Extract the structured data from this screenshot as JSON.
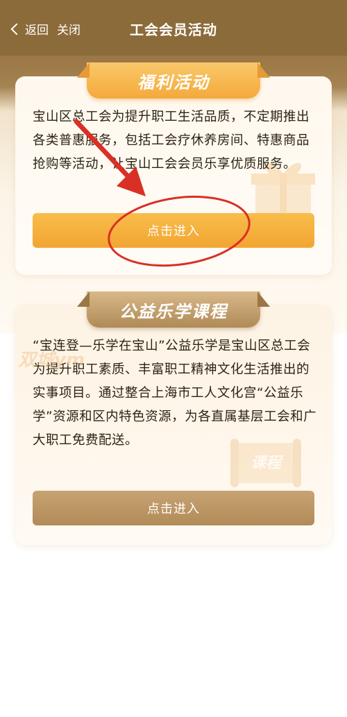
{
  "header": {
    "back_label": "返回",
    "close_label": "关闭",
    "title": "工会会员活动"
  },
  "cards": [
    {
      "title": "福利活动",
      "description": "宝山区总工会为提升职工生活品质，不定期推出各类普惠服务，包括工会疗休养房间、特惠商品抢购等活动，让宝山工会会员乐享优质服务。",
      "button_label": "点击进入"
    },
    {
      "title": "公益乐学课程",
      "description": "“宝连登—乐学在宝山”公益乐学是宝山区总工会为提升职工素质、丰富职工精神文化生活推出的实事项目。通过整合上海市工人文化宫“公益乐学”资源和区内特色资源，为各直属基层工会和广大职工免费配送。",
      "button_label": "点击进入",
      "deco_label": "课程"
    }
  ],
  "watermark": "双城ym",
  "colors": {
    "header_bg": "#8c6b3b",
    "button_orange": "#f5ab36",
    "button_brown": "#b8935f",
    "annotation_red": "#d93025"
  }
}
